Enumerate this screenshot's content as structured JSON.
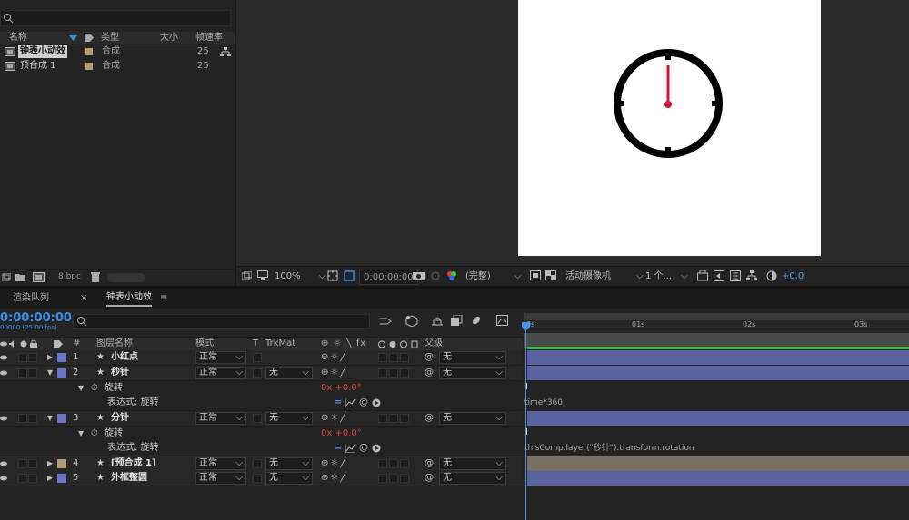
{
  "project": {
    "columns": {
      "name": "名称",
      "type": "类型",
      "size": "大小",
      "fps": "帧速率"
    },
    "items": [
      {
        "name": "钟表小动效",
        "type": "合成",
        "fps": "25"
      },
      {
        "name": "预合成 1",
        "type": "合成",
        "fps": "25"
      }
    ],
    "bpc": "8 bpc"
  },
  "viewer": {
    "zoom": "100%",
    "timecode": "0:00:00:00",
    "resolution": "(完整)",
    "camera": "活动摄像机",
    "views": "1 个...",
    "exposure": "+0.0"
  },
  "timeline": {
    "tabs": [
      {
        "label": "渲染队列"
      },
      {
        "label": "钟表小动效"
      }
    ],
    "timecode": "0:00:00:00",
    "fps_label": "00000 (25.00 fps)",
    "columns": {
      "layer_name": "图层名称",
      "mode": "模式",
      "t": "T",
      "trkmat": "TrkMat",
      "parent": "父级"
    },
    "ruler": [
      "0s",
      "01s",
      "02s",
      "03s"
    ],
    "layers": [
      {
        "num": "1",
        "name": "小红点",
        "mode": "正常",
        "trkmat": "",
        "parent": "无",
        "color": "#6b74c9"
      },
      {
        "num": "2",
        "name": "秒针",
        "mode": "正常",
        "trkmat": "无",
        "parent": "无",
        "color": "#6b74c9"
      },
      {
        "num": "3",
        "name": "分针",
        "mode": "正常",
        "trkmat": "无",
        "parent": "无",
        "color": "#6b74c9"
      },
      {
        "num": "4",
        "name": "[预合成 1]",
        "mode": "正常",
        "trkmat": "无",
        "parent": "无",
        "color": "#b39b73"
      },
      {
        "num": "5",
        "name": "外框整圆",
        "mode": "正常",
        "trkmat": "无",
        "parent": "无",
        "color": "#6b74c9"
      }
    ],
    "props": {
      "rotation_label": "旋转",
      "rotation_value": "0x +0.0°",
      "expression_label": "表达式: 旋转",
      "expr_secondhand": "time*360",
      "expr_minutehand": "thisComp.layer(\"秒针\").transform.rotation"
    }
  },
  "colors": {
    "accent": "#3d8fe0",
    "layer_blue": "#5b62a0",
    "layer_tan": "#7a6f63",
    "hand_red": "#e0103a"
  }
}
